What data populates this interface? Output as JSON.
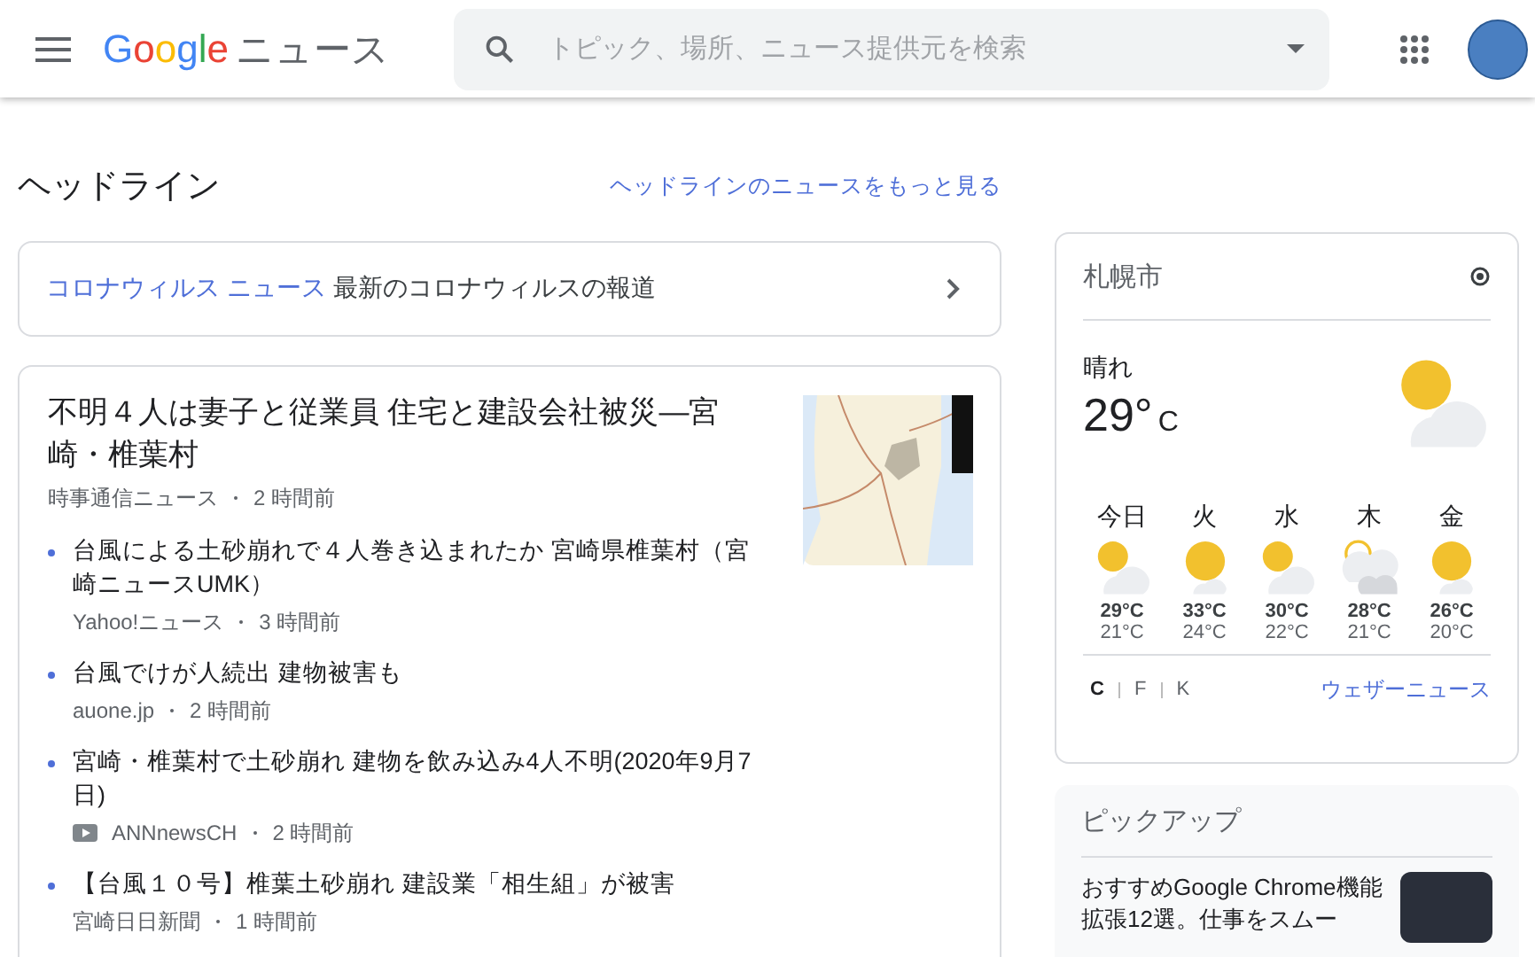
{
  "header": {
    "logo": {
      "letters": [
        {
          "char": "G",
          "color": "#4285f4"
        },
        {
          "char": "o",
          "color": "#ea4335"
        },
        {
          "char": "o",
          "color": "#fbbc05"
        },
        {
          "char": "g",
          "color": "#4285f4"
        },
        {
          "char": "l",
          "color": "#34a853"
        },
        {
          "char": "e",
          "color": "#ea4335"
        }
      ],
      "suffix": "ニュース"
    },
    "search": {
      "placeholder": "トピック、場所、ニュース提供元を検索"
    }
  },
  "headlines": {
    "title": "ヘッドライン",
    "more_link": "ヘッドラインのニュースをもっと見る"
  },
  "covid_banner": {
    "link": "コロナウィルス ニュース",
    "text": "最新のコロナウィルスの報道"
  },
  "top_story": {
    "title": "不明４人は妻子と従業員 住宅と建設会社被災—宮崎・椎葉村",
    "source": "時事通信ニュース",
    "time": "2 時間前",
    "related": [
      {
        "title": "台風による土砂崩れで４人巻き込まれたか 宮崎県椎葉村（宮崎ニュースUMK）",
        "source": "Yahoo!ニュース",
        "time": "3 時間前",
        "video": false
      },
      {
        "title": "台風でけが人続出 建物被害も",
        "source": "auone.jp",
        "time": "2 時間前",
        "video": false
      },
      {
        "title": "宮崎・椎葉村で土砂崩れ 建物を飲み込み4人不明(2020年9月7日)",
        "source": "ANNnewsCH",
        "time": "2 時間前",
        "video": true
      },
      {
        "title": "【台風１０号】椎葉土砂崩れ 建設業「相生組」が被害",
        "source": "宮崎日日新聞",
        "time": "1 時間前",
        "video": false
      }
    ]
  },
  "weather": {
    "city": "札幌市",
    "condition": "晴れ",
    "temp": "29°",
    "unit": "C",
    "kind": "partly-cloudy",
    "forecast": [
      {
        "day": "今日",
        "kind": "partly-cloudy",
        "high": "29°C",
        "low": "21°C"
      },
      {
        "day": "火",
        "kind": "mostly-sunny",
        "high": "33°C",
        "low": "24°C"
      },
      {
        "day": "水",
        "kind": "partly-cloudy",
        "high": "30°C",
        "low": "22°C"
      },
      {
        "day": "木",
        "kind": "cloudy",
        "high": "28°C",
        "low": "21°C"
      },
      {
        "day": "金",
        "kind": "mostly-sunny",
        "high": "26°C",
        "low": "20°C"
      }
    ],
    "units": [
      {
        "label": "C",
        "selected": true
      },
      {
        "label": "F",
        "selected": false
      },
      {
        "label": "K",
        "selected": false
      }
    ],
    "link": "ウェザーニュース"
  },
  "pickup": {
    "title": "ピックアップ",
    "article": "おすすめGoogle Chrome機能拡張12選。仕事をスムー"
  }
}
